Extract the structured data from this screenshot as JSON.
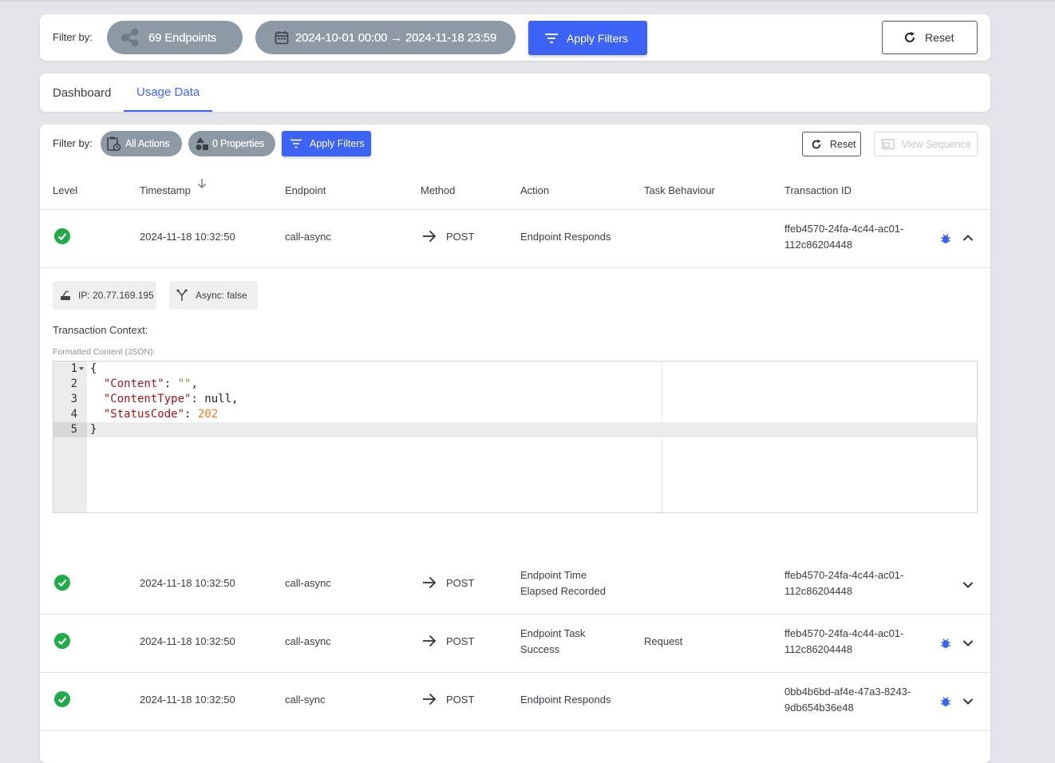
{
  "top_filter": {
    "label": "Filter by:",
    "endpoints_pill": "69 Endpoints",
    "date_pill": "2024-10-01 00:00 → 2024-11-18 23:59",
    "apply_label": "Apply Filters",
    "reset_label": "Reset"
  },
  "tabs": [
    {
      "label": "Dashboard",
      "active": false
    },
    {
      "label": "Usage Data",
      "active": true
    }
  ],
  "usage_filter": {
    "label": "Filter by:",
    "actions_pill": "All Actions",
    "properties_pill": "0 Properties",
    "apply_label": "Apply Filters",
    "reset_label": "Reset",
    "view_sequence_label": "View Sequence"
  },
  "table": {
    "headers": [
      "Level",
      "Timestamp",
      "Endpoint",
      "Method",
      "Action",
      "Task Behaviour",
      "Transaction ID"
    ],
    "rows": [
      {
        "timestamp": "2024-11-18 10:32:50",
        "endpoint": "call-async",
        "method": "POST",
        "action": [
          "Endpoint Responds"
        ],
        "behaviour": "",
        "txid": [
          "ffeb4570-24fa-4c44-ac01-",
          "112c86204448"
        ],
        "bug": true,
        "expanded": true
      },
      {
        "timestamp": "2024-11-18 10:32:50",
        "endpoint": "call-async",
        "method": "POST",
        "action": [
          "Endpoint Time",
          "Elapsed Recorded"
        ],
        "behaviour": "",
        "txid": [
          "ffeb4570-24fa-4c44-ac01-",
          "112c86204448"
        ],
        "bug": false,
        "expanded": false
      },
      {
        "timestamp": "2024-11-18 10:32:50",
        "endpoint": "call-async",
        "method": "POST",
        "action": [
          "Endpoint Task",
          "Success"
        ],
        "behaviour": "Request",
        "txid": [
          "ffeb4570-24fa-4c44-ac01-",
          "112c86204448"
        ],
        "bug": true,
        "expanded": false
      },
      {
        "timestamp": "2024-11-18 10:32:50",
        "endpoint": "call-sync",
        "method": "POST",
        "action": [
          "Endpoint Responds"
        ],
        "behaviour": "",
        "txid": [
          "0bb4b6bd-af4e-47a3-8243-",
          "9db654b36e48"
        ],
        "bug": true,
        "expanded": false
      }
    ]
  },
  "detail": {
    "ip_chip": "IP: 20.77.169.195",
    "async_chip": "Async: false",
    "context_label": "Transaction Context:",
    "format_label": "Formatted Content (JSON):",
    "line_numbers": [
      "1",
      "2",
      "3",
      "4",
      "5"
    ],
    "code": {
      "open": "{",
      "k1": "\"Content\"",
      "v1": "\"\"",
      "k2": "\"ContentType\"",
      "v2": "null",
      "k3": "\"StatusCode\"",
      "v3": "202",
      "close": "}"
    }
  },
  "colors": {
    "primary": "#3d63f5",
    "pill": "#8d99a4",
    "success": "#1fab4a",
    "json_key": "#a3151d",
    "json_string": "#6b8e23",
    "json_number": "#e87e1b"
  }
}
